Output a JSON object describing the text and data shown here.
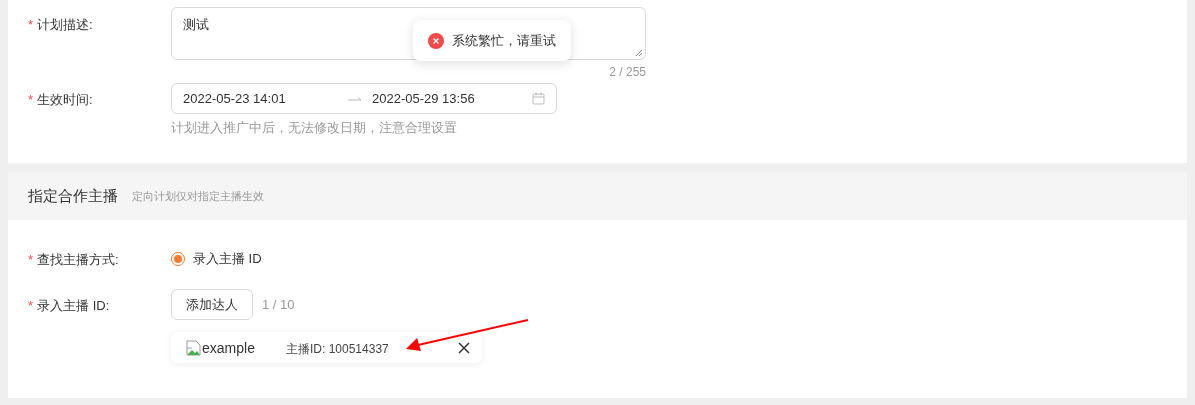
{
  "plan": {
    "fields": [
      {
        "kind": "textarea",
        "mark": "*",
        "label": "计划描述:",
        "value": "测试",
        "counter": "2 / 255"
      },
      {
        "kind": "daterange",
        "mark": "*",
        "label": "生效时间:",
        "start": "2022-05-23 14:01",
        "end": "2022-05-29 13:56",
        "hint": "计划进入推广中后，无法修改日期，注意合理设置"
      }
    ]
  },
  "section": {
    "title": "指定合作主播",
    "subtitle": "定向计划仅对指定主播生效",
    "fields": [
      {
        "kind": "radio",
        "mark": "*",
        "label": "查找主播方式:",
        "options": [
          {
            "label": "录入主播 ID",
            "selected": true
          }
        ]
      },
      {
        "kind": "add",
        "mark": "*",
        "label": "录入主播 ID:",
        "button": "添加达人",
        "count": "1 / 10",
        "items": [
          {
            "image_alt": "example",
            "id_text": "主播ID: 100514337"
          }
        ]
      }
    ]
  },
  "toast": {
    "kind": "error",
    "message": "系统繁忙，请重试"
  },
  "annotation": {
    "kind": "arrow"
  }
}
